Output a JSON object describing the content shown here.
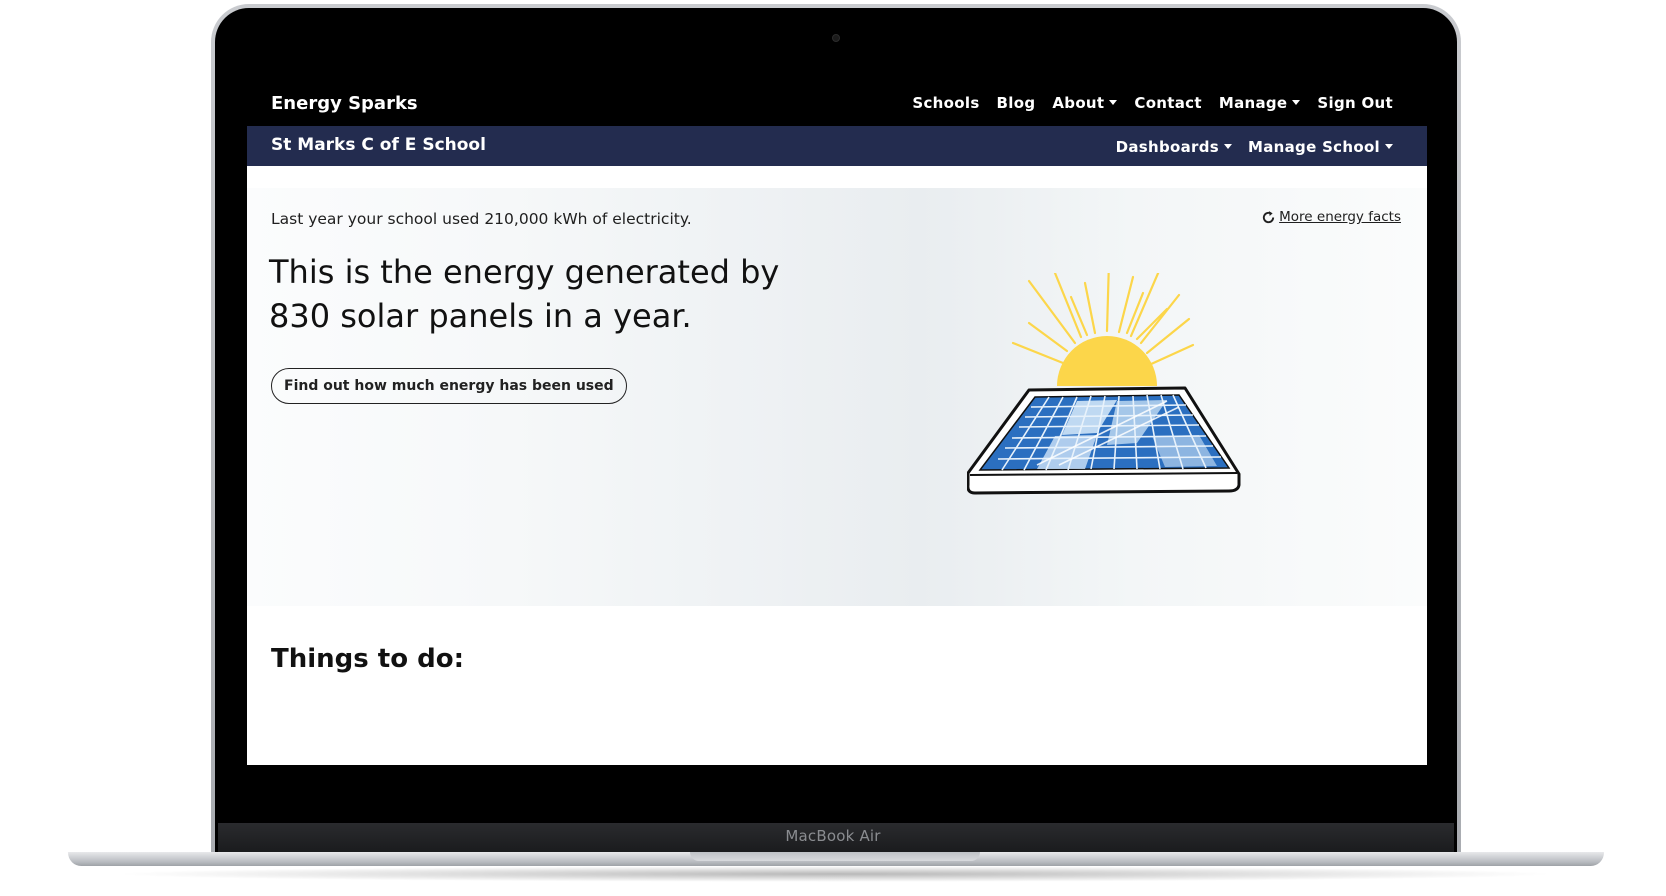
{
  "device": {
    "model_label": "MacBook Air"
  },
  "topnav": {
    "brand": "Energy Sparks",
    "links": [
      {
        "label": "Schools",
        "dropdown": false
      },
      {
        "label": "Blog",
        "dropdown": false
      },
      {
        "label": "About",
        "dropdown": true
      },
      {
        "label": "Contact",
        "dropdown": false
      },
      {
        "label": "Manage",
        "dropdown": true
      },
      {
        "label": "Sign Out",
        "dropdown": false
      }
    ]
  },
  "subnav": {
    "school_name": "St Marks C of E School",
    "links": [
      {
        "label": "Dashboards",
        "dropdown": true
      },
      {
        "label": "Manage School",
        "dropdown": true
      }
    ]
  },
  "hero": {
    "intro": "Last year your school used 210,000 kWh of electricity.",
    "more_facts_label": "More energy facts",
    "headline": "This is the energy generated by 830 solar panels in a year.",
    "button_label": "Find out how much energy has been used",
    "illustration_icon": "solar-panel-sun-illustration",
    "refresh_icon": "refresh-icon"
  },
  "things_to_do": {
    "title": "Things to do:"
  },
  "colors": {
    "topnav_bg": "#000000",
    "subnav_bg": "#232c4f",
    "sun": "#fcd64a",
    "panel_blue": "#2b6fc0",
    "panel_light": "#cfe4f7"
  }
}
